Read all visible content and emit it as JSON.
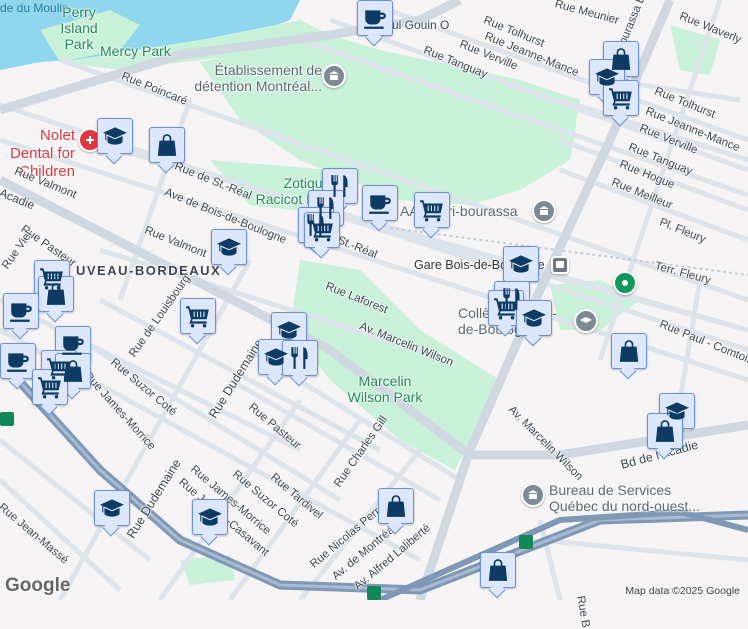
{
  "map": {
    "labels": {
      "water": "de du Moulin",
      "perry": "Perry Island Park",
      "mercy": "Mercy Park",
      "etab": "Établissement de détention Montréal...",
      "poincare": "Rue Poincaré",
      "nolet": "Nolet Dental for Children",
      "valmont1": "Rue Valmont",
      "acadie_w": "Acadie",
      "streal": "Rue de St.-Réal",
      "streal2": "St.-Réal",
      "bois_boulogne_ave": "Ave de Bois-de-Boulogne",
      "zotique": "Zotique-Racicot Park",
      "valmont2": "Rue Valmont",
      "pasteur1": "Rue Pasteur",
      "viel": "Rue Viel",
      "hood": "UVEAU-BORDEAUX",
      "laforest": "Rue Laforest",
      "gouin": "ul Gouin O",
      "meunier": "Rue Meunier",
      "tolhurst1": "Rue Tolhurst",
      "jeanne1": "Rue Jeanne-Mance",
      "verville1": "Rue Verville",
      "tanguay1": "Rue Tanguay",
      "waverly": "Rue Waverly",
      "bourassa": "Bourassa Blvd",
      "tolhurst2": "Rue Tolhurst",
      "jeanne2": "Rue Jeanne-Mance",
      "verville2": "Rue Verville",
      "tanguay2": "Rue Tanguay",
      "hogue": "Rue Hogue",
      "meilleur": "Rue Meilleur",
      "pl_fleury": "Pl. Fleury",
      "terr_fleury": "Terr. Fleury",
      "aaa": "AA Henri-bourassa",
      "gare": "Gare Bois-de-Boulogne",
      "college": "Collège of Bois-de-Boulogne",
      "paul_comtois": "Rue Paul - Comtois",
      "marcelin_ave1": "Av. Marcelin Wilson",
      "marcelin_park": "Marcelin Wilson Park",
      "marcelin_ave2": "Av. Marcelin Wilson",
      "acadie_e": "Bd de l'Acadie",
      "bureau": "Bureau de Services Québec du nord-ouest...",
      "louis": "Rue de Louisbourg",
      "suzor1": "Rue Suzor Coté",
      "james1": "Rue James-Morrice",
      "dudemaine1": "Rue Dudemaine",
      "dudemaine2": "Rue Dudemaine",
      "pasteur2": "Rue Pasteur",
      "charles": "Rue Charles Gill",
      "james2": "Rue James-Morrice",
      "suzor2": "Rue Suzor Coté",
      "tardivel": "Rue Tardivel",
      "casavant": "Rue Joseph-Casavant",
      "jean_masse": "Rue Jean-Massé",
      "nicolas": "Rue Nicolas Perrot",
      "montreal": "Av. de Montréal",
      "alfred": "Av. Alfred Laliberté",
      "rue_b": "Rue B"
    },
    "footer": "Map data ©2025 Google",
    "logo": "Google",
    "colors": {
      "water": "#8fd6ee",
      "park": "#c9f0d8",
      "road": "#d8dee5",
      "highway": "#7f98b5",
      "marker_bg": "#dce7fb",
      "icon": "#0d3b63"
    }
  }
}
